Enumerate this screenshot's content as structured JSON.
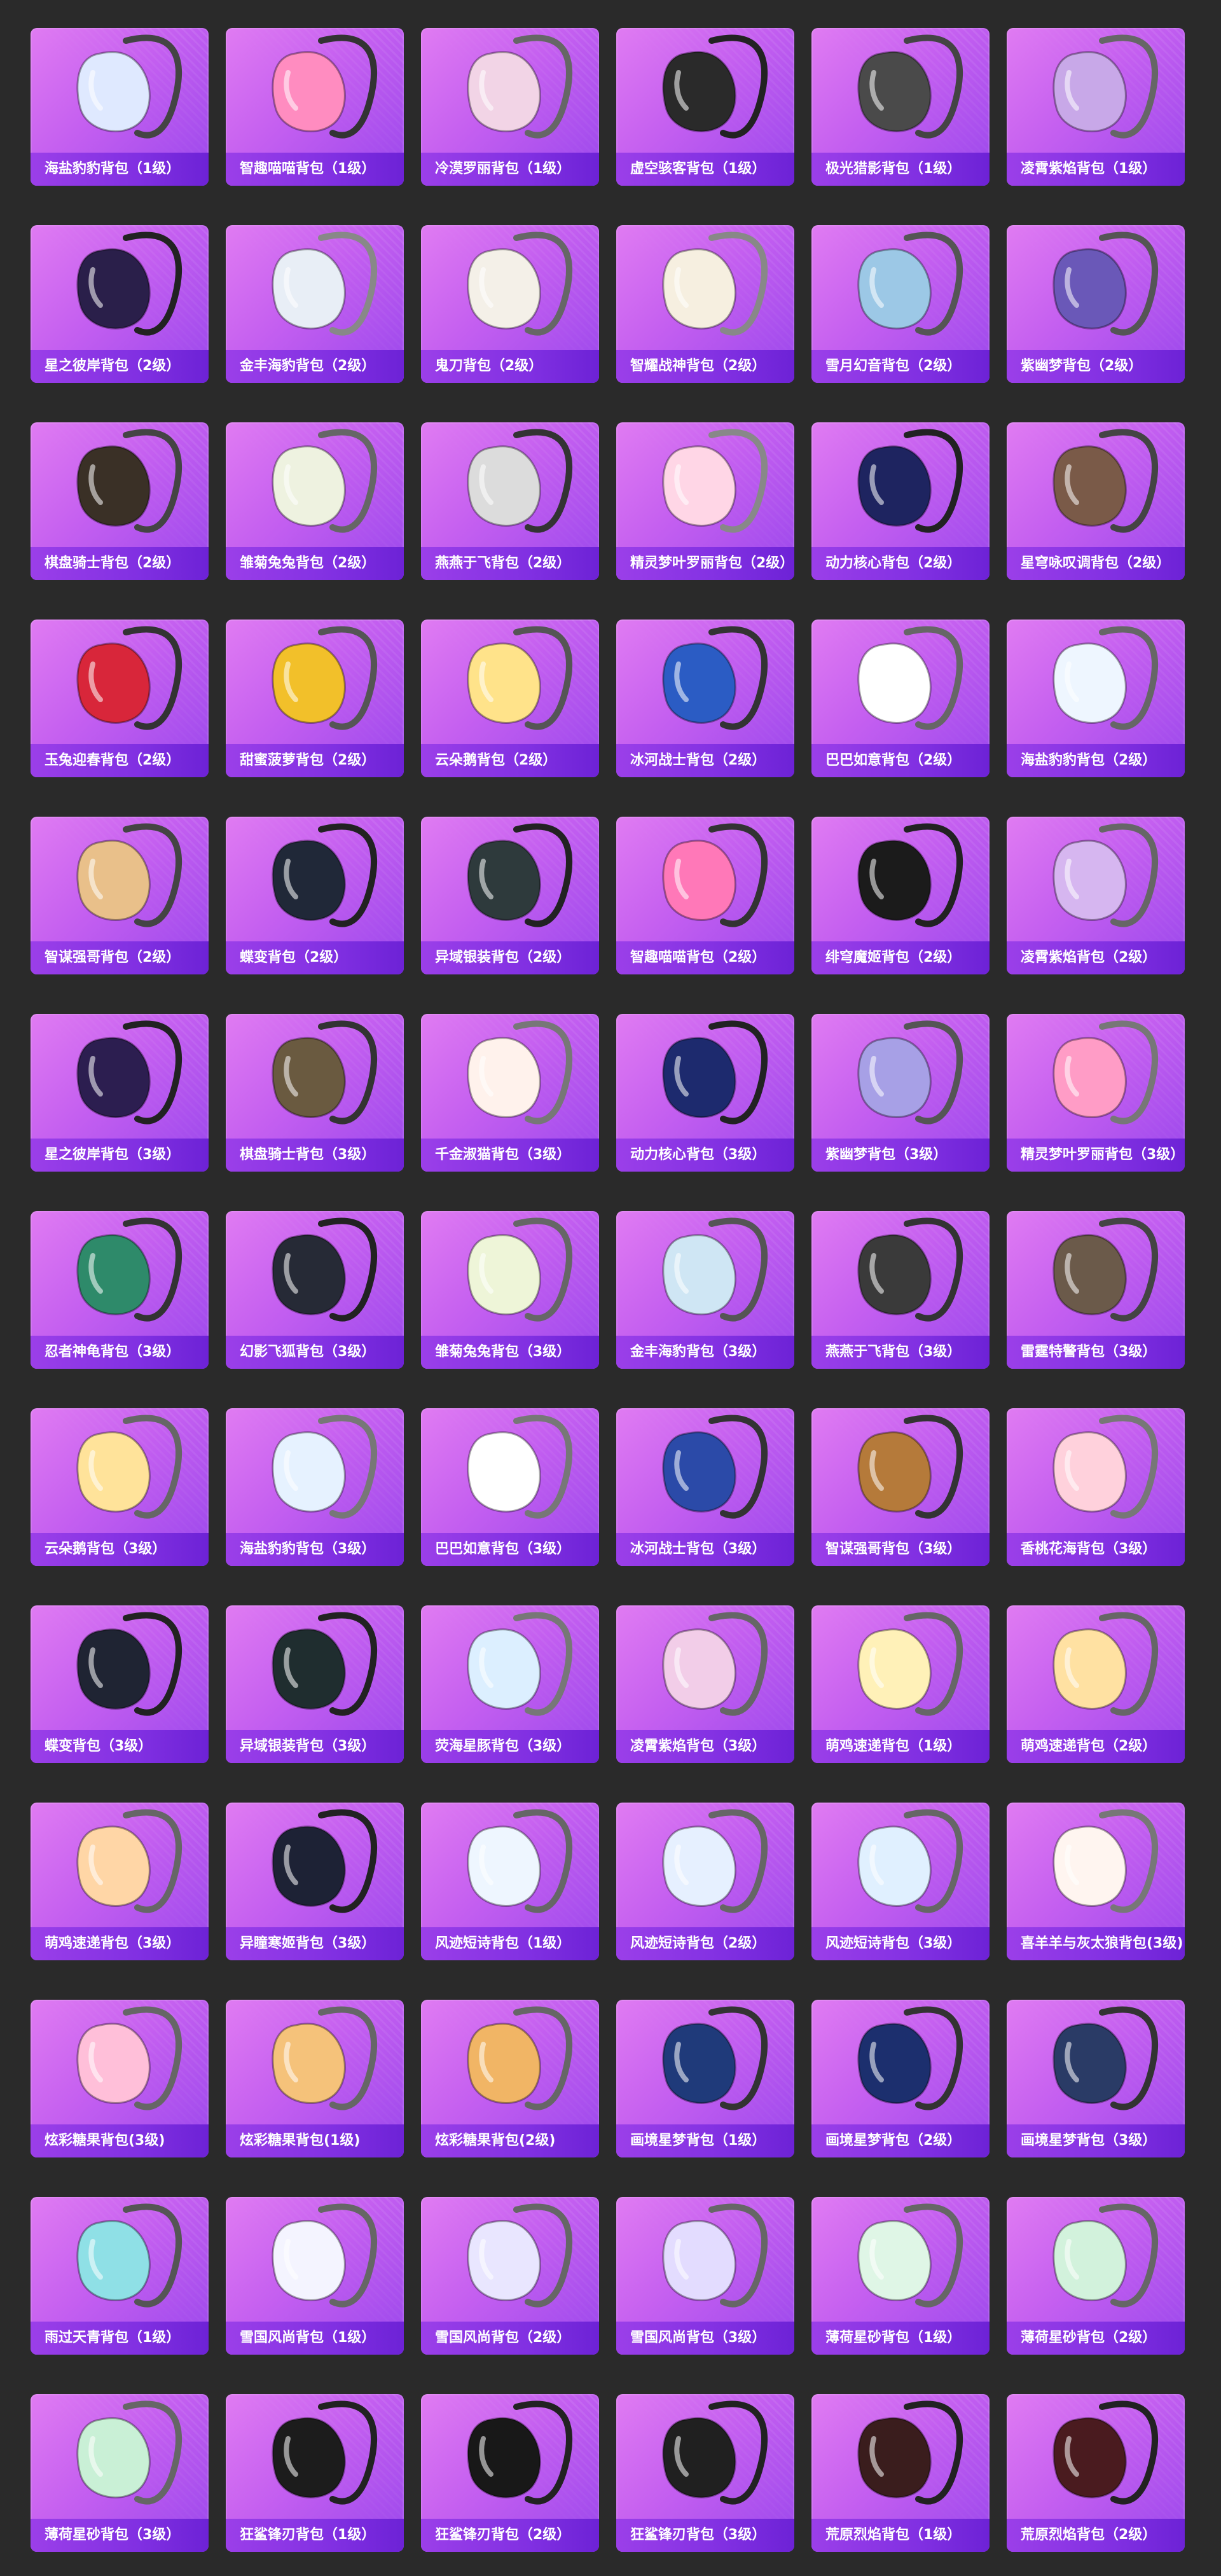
{
  "items": [
    {
      "label": "海盐豹豹背包（1级）",
      "icon": "backpack-icon",
      "color": "#dfe9ff",
      "strap": "#444"
    },
    {
      "label": "智趣喵喵背包（1级）",
      "icon": "backpack-icon",
      "color": "#ff8cc0",
      "strap": "#333"
    },
    {
      "label": "冷漠罗丽背包（1级）",
      "icon": "backpack-icon",
      "color": "#f2d4e6",
      "strap": "#666"
    },
    {
      "label": "虚空骇客背包（1级）",
      "icon": "backpack-icon",
      "color": "#2a2a2a",
      "strap": "#222"
    },
    {
      "label": "极光猎影背包（1级）",
      "icon": "backpack-icon",
      "color": "#4a4a4a",
      "strap": "#444"
    },
    {
      "label": "凌霄紫焰背包（1级）",
      "icon": "backpack-icon",
      "color": "#c8a8e8",
      "strap": "#666"
    },
    {
      "label": "星之彼岸背包（2级）",
      "icon": "backpack-icon",
      "color": "#2a1f4a",
      "strap": "#222"
    },
    {
      "label": "金丰海豹背包（2级）",
      "icon": "backpack-icon",
      "color": "#e8eef6",
      "strap": "#888"
    },
    {
      "label": "鬼刀背包（2级）",
      "icon": "backpack-icon",
      "color": "#f4f0e8",
      "strap": "#666"
    },
    {
      "label": "智耀战神背包（2级）",
      "icon": "backpack-icon",
      "color": "#f6efe0",
      "strap": "#888"
    },
    {
      "label": "雪月幻音背包（2级）",
      "icon": "backpack-icon",
      "color": "#9cc8e6",
      "strap": "#555"
    },
    {
      "label": "紫幽梦背包（2级）",
      "icon": "backpack-icon",
      "color": "#6a58b8",
      "strap": "#555"
    },
    {
      "label": "棋盘骑士背包（2级）",
      "icon": "backpack-icon",
      "color": "#3a3026",
      "strap": "#444"
    },
    {
      "label": "雏菊兔兔背包（2级）",
      "icon": "backpack-icon",
      "color": "#eef2e0",
      "strap": "#666"
    },
    {
      "label": "燕燕于飞背包（2级）",
      "icon": "backpack-icon",
      "color": "#dcdcdc",
      "strap": "#333"
    },
    {
      "label": "精灵梦叶罗丽背包（2级）",
      "icon": "backpack-icon",
      "color": "#ffd6e6",
      "strap": "#888"
    },
    {
      "label": "动力核心背包（2级）",
      "icon": "backpack-icon",
      "color": "#1e2460",
      "strap": "#222"
    },
    {
      "label": "星穹咏叹调背包（2级）",
      "icon": "backpack-icon",
      "color": "#7a5a48",
      "strap": "#444"
    },
    {
      "label": "玉兔迎春背包（2级）",
      "icon": "backpack-icon",
      "color": "#d8263a",
      "strap": "#333"
    },
    {
      "label": "甜蜜菠萝背包（2级）",
      "icon": "backpack-icon",
      "color": "#f2c02a",
      "strap": "#555"
    },
    {
      "label": "云朵鹅背包（2级）",
      "icon": "backpack-icon",
      "color": "#ffe38a",
      "strap": "#555"
    },
    {
      "label": "冰河战士背包（2级）",
      "icon": "backpack-icon",
      "color": "#2b5cc4",
      "strap": "#333"
    },
    {
      "label": "巴巴如意背包（2级）",
      "icon": "backpack-icon",
      "color": "#ffffff",
      "strap": "#666"
    },
    {
      "label": "海盐豹豹背包（2级）",
      "icon": "backpack-icon",
      "color": "#eef6ff",
      "strap": "#666"
    },
    {
      "label": "智谋强哥背包（2级）",
      "icon": "backpack-icon",
      "color": "#e9c08a",
      "strap": "#444"
    },
    {
      "label": "蝶变背包（2级）",
      "icon": "backpack-icon",
      "color": "#202838",
      "strap": "#222"
    },
    {
      "label": "异域银装背包（2级）",
      "icon": "backpack-icon",
      "color": "#2e3a3c",
      "strap": "#222"
    },
    {
      "label": "智趣喵喵背包（2级）",
      "icon": "backpack-icon",
      "color": "#ff78b8",
      "strap": "#333"
    },
    {
      "label": "绯穹魔姬背包（2级）",
      "icon": "backpack-icon",
      "color": "#1b1b1b",
      "strap": "#222"
    },
    {
      "label": "凌霄紫焰背包（2级）",
      "icon": "backpack-icon",
      "color": "#d6b6f0",
      "strap": "#666"
    },
    {
      "label": "星之彼岸背包（3级）",
      "icon": "backpack-icon",
      "color": "#2c1e50",
      "strap": "#222"
    },
    {
      "label": "棋盘骑士背包（3级）",
      "icon": "backpack-icon",
      "color": "#6a5a40",
      "strap": "#333"
    },
    {
      "label": "千金淑猫背包（3级）",
      "icon": "backpack-icon",
      "color": "#fff2ec",
      "strap": "#777"
    },
    {
      "label": "动力核心背包（3级）",
      "icon": "backpack-icon",
      "color": "#1d2a6e",
      "strap": "#222"
    },
    {
      "label": "紫幽梦背包（3级）",
      "icon": "backpack-icon",
      "color": "#a7a0e6",
      "strap": "#555"
    },
    {
      "label": "精灵梦叶罗丽背包（3级）",
      "icon": "backpack-icon",
      "color": "#ff9cc6",
      "strap": "#777"
    },
    {
      "label": "忍者神龟背包（3级）",
      "icon": "backpack-icon",
      "color": "#2e8a6a",
      "strap": "#333"
    },
    {
      "label": "幻影飞狐背包（3级）",
      "icon": "backpack-icon",
      "color": "#262a36",
      "strap": "#222"
    },
    {
      "label": "雏菊兔兔背包（3级）",
      "icon": "backpack-icon",
      "color": "#eef5d8",
      "strap": "#666"
    },
    {
      "label": "金丰海豹背包（3级）",
      "icon": "backpack-icon",
      "color": "#cfe6f4",
      "strap": "#555"
    },
    {
      "label": "燕燕于飞背包（3级）",
      "icon": "backpack-icon",
      "color": "#3a3a3a",
      "strap": "#333"
    },
    {
      "label": "雷霆特警背包（3级）",
      "icon": "backpack-icon",
      "color": "#6b5a4a",
      "strap": "#444"
    },
    {
      "label": "云朵鹅背包（3级）",
      "icon": "backpack-icon",
      "color": "#ffe39a",
      "strap": "#666"
    },
    {
      "label": "海盐豹豹背包（3级）",
      "icon": "backpack-icon",
      "color": "#e6f2ff",
      "strap": "#777"
    },
    {
      "label": "巴巴如意背包（3级）",
      "icon": "backpack-icon",
      "color": "#ffffff",
      "strap": "#777"
    },
    {
      "label": "冰河战士背包（3级）",
      "icon": "backpack-icon",
      "color": "#2b4aa8",
      "strap": "#333"
    },
    {
      "label": "智谋强哥背包（3级）",
      "icon": "backpack-icon",
      "color": "#b57a3a",
      "strap": "#333"
    },
    {
      "label": "香桃花海背包（3级）",
      "icon": "backpack-icon",
      "color": "#ffd1dc",
      "strap": "#777"
    },
    {
      "label": "蝶变背包（3级）",
      "icon": "backpack-icon",
      "color": "#1f2433",
      "strap": "#222"
    },
    {
      "label": "异域银装背包（3级）",
      "icon": "backpack-icon",
      "color": "#1f2d2f",
      "strap": "#222"
    },
    {
      "label": "荧海星豚背包（3级）",
      "icon": "backpack-icon",
      "color": "#dcefff",
      "strap": "#777"
    },
    {
      "label": "凌霄紫焰背包（3级）",
      "icon": "backpack-icon",
      "color": "#f2cde8",
      "strap": "#666"
    },
    {
      "label": "萌鸡速递背包（1级）",
      "icon": "backpack-icon",
      "color": "#fff1b8",
      "strap": "#666"
    },
    {
      "label": "萌鸡速递背包（2级）",
      "icon": "backpack-icon",
      "color": "#ffe1a2",
      "strap": "#666"
    },
    {
      "label": "萌鸡速递背包（3级）",
      "icon": "backpack-icon",
      "color": "#ffd6a6",
      "strap": "#666"
    },
    {
      "label": "异瞳寒姬背包（3级）",
      "icon": "backpack-icon",
      "color": "#1d2235",
      "strap": "#222"
    },
    {
      "label": "风迹短诗背包（1级）",
      "icon": "backpack-icon",
      "color": "#eef6ff",
      "strap": "#666"
    },
    {
      "label": "风迹短诗背包（2级）",
      "icon": "backpack-icon",
      "color": "#e6f0ff",
      "strap": "#666"
    },
    {
      "label": "风迹短诗背包（3级）",
      "icon": "backpack-icon",
      "color": "#e0f0ff",
      "strap": "#666"
    },
    {
      "label": "喜羊羊与灰太狼背包(3级)",
      "icon": "backpack-icon",
      "color": "#fff5f0",
      "strap": "#777"
    },
    {
      "label": "炫彩糖果背包(3级)",
      "icon": "backpack-icon",
      "color": "#ffbfd9",
      "strap": "#666"
    },
    {
      "label": "炫彩糖果背包(1级)",
      "icon": "backpack-icon",
      "color": "#f5c27a",
      "strap": "#666"
    },
    {
      "label": "炫彩糖果背包(2级)",
      "icon": "backpack-icon",
      "color": "#f1b565",
      "strap": "#666"
    },
    {
      "label": "画境星梦背包（1级）",
      "icon": "backpack-icon",
      "color": "#1f3a7a",
      "strap": "#333"
    },
    {
      "label": "画境星梦背包（2级）",
      "icon": "backpack-icon",
      "color": "#1c2f6e",
      "strap": "#333"
    },
    {
      "label": "画境星梦背包（3级）",
      "icon": "backpack-icon",
      "color": "#2a3b66",
      "strap": "#333"
    },
    {
      "label": "雨过天青背包（1级）",
      "icon": "backpack-icon",
      "color": "#8fe0e6",
      "strap": "#555"
    },
    {
      "label": "雪国风尚背包（1级）",
      "icon": "backpack-icon",
      "color": "#f4f4ff",
      "strap": "#666"
    },
    {
      "label": "雪国风尚背包（2级）",
      "icon": "backpack-icon",
      "color": "#e9e6ff",
      "strap": "#666"
    },
    {
      "label": "雪国风尚背包（3级）",
      "icon": "backpack-icon",
      "color": "#e3dcff",
      "strap": "#666"
    },
    {
      "label": "薄荷星砂背包（1级）",
      "icon": "backpack-icon",
      "color": "#dff6e6",
      "strap": "#666"
    },
    {
      "label": "薄荷星砂背包（2级）",
      "icon": "backpack-icon",
      "color": "#d2f2dc",
      "strap": "#666"
    },
    {
      "label": "薄荷星砂背包（3级）",
      "icon": "backpack-icon",
      "color": "#c9f0d6",
      "strap": "#666"
    },
    {
      "label": "狂鲨锋刃背包（1级）",
      "icon": "backpack-icon",
      "color": "#1c1c1c",
      "strap": "#222"
    },
    {
      "label": "狂鲨锋刃背包（2级）",
      "icon": "backpack-icon",
      "color": "#181818",
      "strap": "#222"
    },
    {
      "label": "狂鲨锋刃背包（3级）",
      "icon": "backpack-icon",
      "color": "#202020",
      "strap": "#222"
    },
    {
      "label": "荒原烈焰背包（1级）",
      "icon": "backpack-icon",
      "color": "#3a1d1d",
      "strap": "#222"
    },
    {
      "label": "荒原烈焰背包（2级）",
      "icon": "backpack-icon",
      "color": "#4a1b1f",
      "strap": "#222"
    }
  ]
}
